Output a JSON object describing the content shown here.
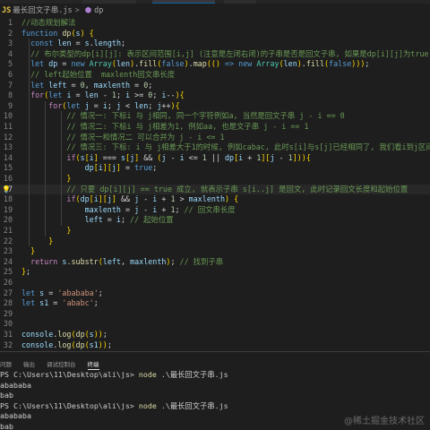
{
  "breadcrumb": {
    "lang_badge": "JS",
    "file": "最长回文子串.js",
    "separator": ">",
    "symbol": "dp"
  },
  "editor": {
    "lines": [
      {
        "n": "1",
        "tokens": [
          [
            "c",
            "//动态规划解法"
          ]
        ]
      },
      {
        "n": "2",
        "tokens": [
          [
            "k",
            "function "
          ],
          [
            "f",
            "dp"
          ],
          [
            "b",
            "("
          ],
          [
            "v",
            "s"
          ],
          [
            "b",
            ")"
          ],
          [
            "p",
            " "
          ],
          [
            "b",
            "{"
          ]
        ]
      },
      {
        "n": "3",
        "tokens": [
          [
            "p",
            "  "
          ],
          [
            "k",
            "const "
          ],
          [
            "v",
            "len"
          ],
          [
            "p",
            " = "
          ],
          [
            "v",
            "s"
          ],
          [
            "p",
            "."
          ],
          [
            "v",
            "length"
          ],
          [
            "p",
            ";"
          ]
        ]
      },
      {
        "n": "4",
        "tokens": [
          [
            "p",
            "  "
          ],
          [
            "c",
            "// 布尔类型的dp[i][j]: 表示区间范围[i,j] (注意是左闭右闭)的子串是否是回文子串, 如果是dp[i][j]为true, 否则为false"
          ]
        ]
      },
      {
        "n": "5",
        "tokens": [
          [
            "p",
            "  "
          ],
          [
            "k",
            "let "
          ],
          [
            "v",
            "dp"
          ],
          [
            "p",
            " = "
          ],
          [
            "k",
            "new "
          ],
          [
            "t",
            "Array"
          ],
          [
            "b",
            "("
          ],
          [
            "v",
            "len"
          ],
          [
            "b",
            ")"
          ],
          [
            "p",
            "."
          ],
          [
            "f",
            "fill"
          ],
          [
            "b",
            "("
          ],
          [
            "k",
            "false"
          ],
          [
            "b",
            ")"
          ],
          [
            "p",
            "."
          ],
          [
            "f",
            "map"
          ],
          [
            "b",
            "("
          ],
          [
            "b",
            "()"
          ],
          [
            "p",
            " "
          ],
          [
            "k",
            "=>"
          ],
          [
            "p",
            " "
          ],
          [
            "k",
            "new "
          ],
          [
            "t",
            "Array"
          ],
          [
            "b",
            "("
          ],
          [
            "v",
            "len"
          ],
          [
            "b",
            ")"
          ],
          [
            "p",
            "."
          ],
          [
            "f",
            "fill"
          ],
          [
            "b",
            "("
          ],
          [
            "k",
            "false"
          ],
          [
            "b",
            "))"
          ],
          [
            "b",
            ")"
          ],
          [
            "p",
            ";"
          ]
        ]
      },
      {
        "n": "6",
        "tokens": [
          [
            "p",
            "  "
          ],
          [
            "c",
            "// left起始位置  maxlenth回文串长度"
          ]
        ]
      },
      {
        "n": "7",
        "tokens": [
          [
            "p",
            "  "
          ],
          [
            "k",
            "let "
          ],
          [
            "v",
            "left"
          ],
          [
            "p",
            " = "
          ],
          [
            "n",
            "0"
          ],
          [
            "p",
            ", "
          ],
          [
            "v",
            "maxlenth"
          ],
          [
            "p",
            " = "
          ],
          [
            "n",
            "0"
          ],
          [
            "p",
            ";"
          ]
        ]
      },
      {
        "n": "8",
        "tokens": [
          [
            "p",
            "  "
          ],
          [
            "kc",
            "for"
          ],
          [
            "b",
            "("
          ],
          [
            "k",
            "let "
          ],
          [
            "v",
            "i"
          ],
          [
            "p",
            " = "
          ],
          [
            "v",
            "len"
          ],
          [
            "p",
            " - "
          ],
          [
            "n",
            "1"
          ],
          [
            "p",
            "; "
          ],
          [
            "v",
            "i"
          ],
          [
            "p",
            " >= "
          ],
          [
            "n",
            "0"
          ],
          [
            "p",
            "; "
          ],
          [
            "v",
            "i"
          ],
          [
            "p",
            "--"
          ],
          [
            "b",
            ")"
          ],
          [
            "b",
            "{"
          ]
        ]
      },
      {
        "n": "9",
        "tokens": [
          [
            "p",
            "      "
          ],
          [
            "kc",
            "for"
          ],
          [
            "b",
            "("
          ],
          [
            "k",
            "let "
          ],
          [
            "v",
            "j"
          ],
          [
            "p",
            " = "
          ],
          [
            "v",
            "i"
          ],
          [
            "p",
            "; "
          ],
          [
            "v",
            "j"
          ],
          [
            "p",
            " < "
          ],
          [
            "v",
            "len"
          ],
          [
            "p",
            "; "
          ],
          [
            "v",
            "j"
          ],
          [
            "p",
            "++"
          ],
          [
            "b",
            ")"
          ],
          [
            "b",
            "{"
          ]
        ]
      },
      {
        "n": "10",
        "tokens": [
          [
            "p",
            "          "
          ],
          [
            "c",
            "// 情况一: 下标i 与 j相同, 同一个字符例如a, 当然是回文子串 j - i == 0"
          ]
        ]
      },
      {
        "n": "11",
        "tokens": [
          [
            "p",
            "          "
          ],
          [
            "c",
            "// 情况二: 下标i 与 j相差为1, 例如aa, 也是文子串 j - i == 1"
          ]
        ]
      },
      {
        "n": "12",
        "tokens": [
          [
            "p",
            "          "
          ],
          [
            "c",
            "// 情况一和情况二 可以合并为 j - i <= 1"
          ]
        ]
      },
      {
        "n": "13",
        "tokens": [
          [
            "p",
            "          "
          ],
          [
            "c",
            "// 情况三: 下标: i 与 j相差大于1的时候, 例如cabac, 此时s[i]与s[j]已经相同了, 我们看i到j区间是不是回文子串"
          ]
        ]
      },
      {
        "n": "14",
        "tokens": [
          [
            "p",
            "          "
          ],
          [
            "kc",
            "if"
          ],
          [
            "b",
            "("
          ],
          [
            "v",
            "s"
          ],
          [
            "b",
            "["
          ],
          [
            "v",
            "i"
          ],
          [
            "b",
            "]"
          ],
          [
            "p",
            " === "
          ],
          [
            "v",
            "s"
          ],
          [
            "b",
            "["
          ],
          [
            "v",
            "j"
          ],
          [
            "b",
            "]"
          ],
          [
            "p",
            " && "
          ],
          [
            "b",
            "("
          ],
          [
            "v",
            "j"
          ],
          [
            "p",
            " - "
          ],
          [
            "v",
            "i"
          ],
          [
            "p",
            " <= "
          ],
          [
            "n",
            "1"
          ],
          [
            "p",
            " || "
          ],
          [
            "v",
            "dp"
          ],
          [
            "b",
            "["
          ],
          [
            "v",
            "i"
          ],
          [
            "p",
            " + "
          ],
          [
            "n",
            "1"
          ],
          [
            "b",
            "]"
          ],
          [
            "b",
            "["
          ],
          [
            "v",
            "j"
          ],
          [
            "p",
            " - "
          ],
          [
            "n",
            "1"
          ],
          [
            "b",
            "]"
          ],
          [
            "b",
            ")"
          ],
          [
            "b",
            ")"
          ],
          [
            "b",
            "{"
          ]
        ]
      },
      {
        "n": "15",
        "tokens": [
          [
            "p",
            "              "
          ],
          [
            "v",
            "dp"
          ],
          [
            "b",
            "["
          ],
          [
            "v",
            "i"
          ],
          [
            "b",
            "]"
          ],
          [
            "b",
            "["
          ],
          [
            "v",
            "j"
          ],
          [
            "b",
            "]"
          ],
          [
            "p",
            " = "
          ],
          [
            "k",
            "true"
          ],
          [
            "p",
            ";"
          ]
        ]
      },
      {
        "n": "16",
        "tokens": [
          [
            "p",
            "          "
          ],
          [
            "b",
            "}"
          ]
        ]
      },
      {
        "n": "17",
        "tokens": [
          [
            "p",
            "          "
          ],
          [
            "c",
            "// 只要 dp[i][j] == true 成立, 就表示子串 s[i..j] 是回文, 此时记录回文长度和起始位置"
          ]
        ]
      },
      {
        "n": "18",
        "tokens": [
          [
            "p",
            "          "
          ],
          [
            "kc",
            "if"
          ],
          [
            "b",
            "("
          ],
          [
            "v",
            "dp"
          ],
          [
            "b",
            "["
          ],
          [
            "v",
            "i"
          ],
          [
            "b",
            "]"
          ],
          [
            "b",
            "["
          ],
          [
            "v",
            "j"
          ],
          [
            "b",
            "]"
          ],
          [
            "p",
            " && "
          ],
          [
            "v",
            "j"
          ],
          [
            "p",
            " - "
          ],
          [
            "v",
            "i"
          ],
          [
            "p",
            " + "
          ],
          [
            "n",
            "1"
          ],
          [
            "p",
            " > "
          ],
          [
            "v",
            "maxlenth"
          ],
          [
            "b",
            ")"
          ],
          [
            "p",
            " "
          ],
          [
            "b",
            "{"
          ]
        ]
      },
      {
        "n": "19",
        "tokens": [
          [
            "p",
            "              "
          ],
          [
            "v",
            "maxlenth"
          ],
          [
            "p",
            " = "
          ],
          [
            "v",
            "j"
          ],
          [
            "p",
            " - "
          ],
          [
            "v",
            "i"
          ],
          [
            "p",
            " + "
          ],
          [
            "n",
            "1"
          ],
          [
            "p",
            "; "
          ],
          [
            "c",
            "// 回文串长度"
          ]
        ]
      },
      {
        "n": "20",
        "tokens": [
          [
            "p",
            "              "
          ],
          [
            "v",
            "left"
          ],
          [
            "p",
            " = "
          ],
          [
            "v",
            "i"
          ],
          [
            "p",
            "; "
          ],
          [
            "c",
            "// 起始位置"
          ]
        ]
      },
      {
        "n": "21",
        "tokens": [
          [
            "p",
            "          "
          ],
          [
            "b",
            "}"
          ]
        ]
      },
      {
        "n": "22",
        "tokens": [
          [
            "p",
            "      "
          ],
          [
            "b",
            "}"
          ]
        ]
      },
      {
        "n": "23",
        "tokens": [
          [
            "p",
            "  "
          ],
          [
            "b",
            "}"
          ]
        ]
      },
      {
        "n": "24",
        "tokens": [
          [
            "p",
            "  "
          ],
          [
            "kc",
            "return "
          ],
          [
            "v",
            "s"
          ],
          [
            "p",
            "."
          ],
          [
            "f",
            "substr"
          ],
          [
            "b",
            "("
          ],
          [
            "v",
            "left"
          ],
          [
            "p",
            ", "
          ],
          [
            "v",
            "maxlenth"
          ],
          [
            "b",
            ")"
          ],
          [
            "p",
            "; "
          ],
          [
            "c",
            "// 找到子串"
          ]
        ]
      },
      {
        "n": "25",
        "tokens": [
          [
            "b",
            "}"
          ],
          [
            "p",
            ";"
          ]
        ]
      },
      {
        "n": "26",
        "tokens": []
      },
      {
        "n": "27",
        "tokens": [
          [
            "k",
            "let "
          ],
          [
            "v",
            "s"
          ],
          [
            "p",
            " = "
          ],
          [
            "s",
            "'abababa'"
          ],
          [
            "p",
            ";"
          ]
        ]
      },
      {
        "n": "28",
        "tokens": [
          [
            "k",
            "let "
          ],
          [
            "v",
            "s1"
          ],
          [
            "p",
            " = "
          ],
          [
            "s",
            "'ababc'"
          ],
          [
            "p",
            ";"
          ]
        ]
      },
      {
        "n": "29",
        "tokens": []
      },
      {
        "n": "30",
        "tokens": []
      },
      {
        "n": "31",
        "tokens": [
          [
            "v",
            "console"
          ],
          [
            "p",
            "."
          ],
          [
            "f",
            "log"
          ],
          [
            "b",
            "("
          ],
          [
            "f",
            "dp"
          ],
          [
            "b",
            "("
          ],
          [
            "v",
            "s"
          ],
          [
            "b",
            "))"
          ],
          [
            "p",
            ";"
          ]
        ]
      },
      {
        "n": "32",
        "tokens": [
          [
            "v",
            "console"
          ],
          [
            "p",
            "."
          ],
          [
            "f",
            "log"
          ],
          [
            "b",
            "("
          ],
          [
            "f",
            "dp"
          ],
          [
            "b",
            "("
          ],
          [
            "v",
            "s1"
          ],
          [
            "b",
            "))"
          ],
          [
            "p",
            ";"
          ]
        ]
      }
    ],
    "current_line": "17"
  },
  "panel": {
    "tabs": [
      "问题",
      "输出",
      "调试控制台",
      "终端"
    ],
    "active_tab": "终端"
  },
  "terminal": {
    "lines": [
      {
        "prompt": "PS C:\\Users\\11\\Desktop\\ali\\js> ",
        "cmd": "node",
        "arg": " .\\最长回文子串.js"
      },
      {
        "output": "abababa"
      },
      {
        "output": "bab"
      },
      {
        "prompt": "PS C:\\Users\\11\\Desktop\\ali\\js> ",
        "cmd": "node",
        "arg": " .\\最长回文子串.js"
      },
      {
        "output": "abababa"
      },
      {
        "output": "bab"
      },
      {
        "prompt": "PS C:\\Users\\11\\Desktop\\ali\\js> ",
        "ctl": "^C"
      }
    ]
  },
  "watermark": "@稀土掘金技术社区",
  "colors": {
    "background": "#1e1e1e",
    "keyword": "#569cd6",
    "control": "#c586c0",
    "function": "#dcdcaa",
    "variable": "#9cdcfe",
    "number": "#b5cea8",
    "string": "#ce9178",
    "comment": "#6a9955",
    "type": "#4ec9b0",
    "bracket": "#ffd700"
  }
}
